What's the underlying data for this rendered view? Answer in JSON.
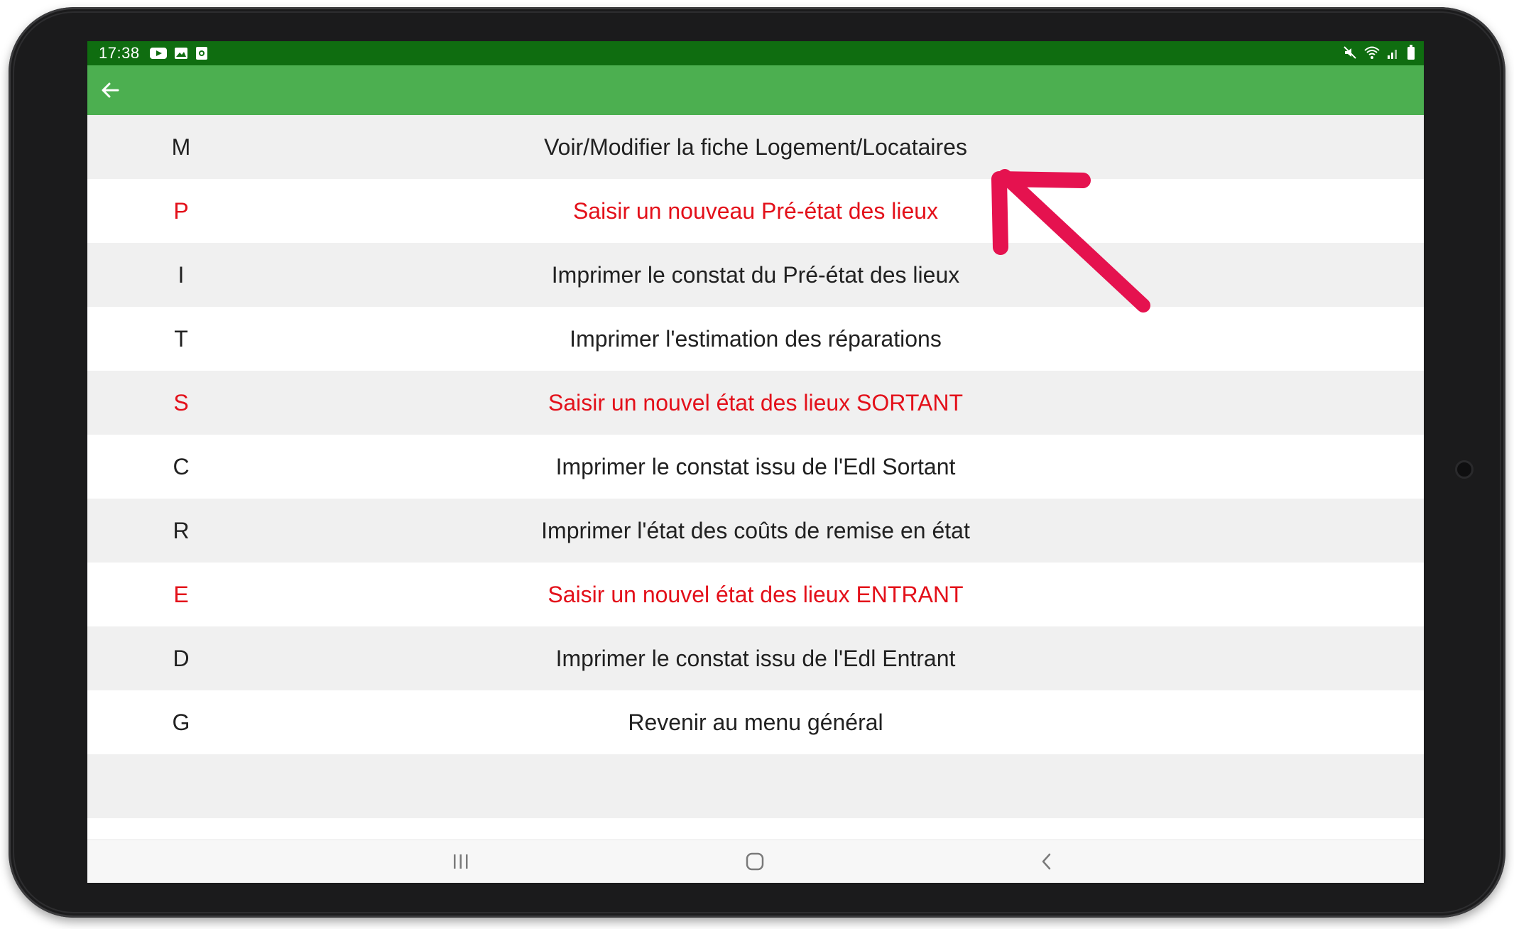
{
  "status_bar": {
    "time": "17:38",
    "left_icons": [
      "youtube-icon",
      "gallery-icon",
      "screenshot-icon"
    ],
    "right_icons": [
      "mute-icon",
      "wifi-icon",
      "signal-icon",
      "battery-icon"
    ]
  },
  "app_bar": {
    "back_icon": "arrow-left-icon"
  },
  "menu": {
    "items": [
      {
        "key": "M",
        "label": "Voir/Modifier la fiche Logement/Locataires",
        "highlight": false
      },
      {
        "key": "P",
        "label": "Saisir un nouveau Pré-état des lieux",
        "highlight": true
      },
      {
        "key": "I",
        "label": "Imprimer le constat du Pré-état des lieux",
        "highlight": false
      },
      {
        "key": "T",
        "label": "Imprimer l'estimation des réparations",
        "highlight": false
      },
      {
        "key": "S",
        "label": "Saisir un nouvel état des lieux SORTANT",
        "highlight": true
      },
      {
        "key": "C",
        "label": "Imprimer le constat issu de l'Edl Sortant",
        "highlight": false
      },
      {
        "key": "R",
        "label": "Imprimer l'état des coûts de remise en état",
        "highlight": false
      },
      {
        "key": "E",
        "label": "Saisir un nouvel état des lieux ENTRANT",
        "highlight": true
      },
      {
        "key": "D",
        "label": "Imprimer le constat issu de l'Edl Entrant",
        "highlight": false
      },
      {
        "key": "G",
        "label": "Revenir au menu général",
        "highlight": false
      }
    ]
  },
  "nav_bar": {
    "icons": [
      "recent-apps-icon",
      "home-icon",
      "back-icon"
    ]
  },
  "colors": {
    "status_bar": "#0f6d10",
    "app_bar": "#4caf50",
    "highlight_text": "#e3101a",
    "annotation_arrow": "#e5124f"
  }
}
